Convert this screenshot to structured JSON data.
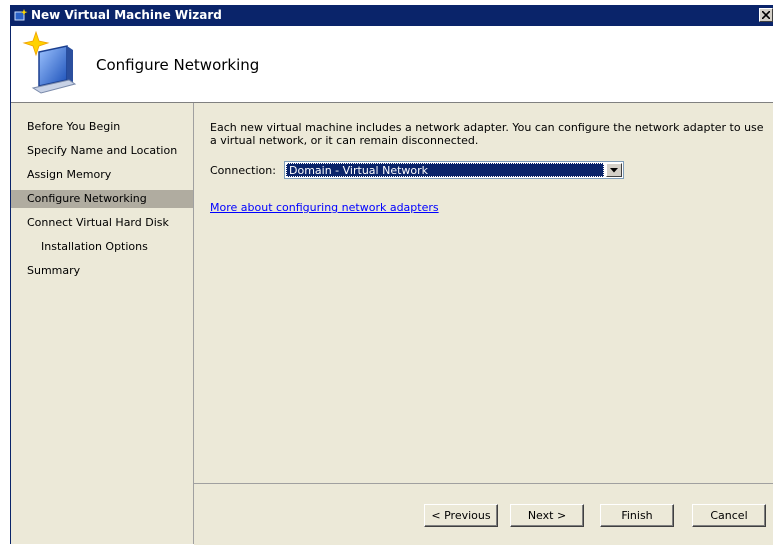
{
  "window": {
    "title": "New Virtual Machine Wizard",
    "close_glyph": "×",
    "icons": {
      "title": "wizard-app-icon",
      "header": "wizard-computer-icon"
    },
    "colors": {
      "titlebar": "#0a246a",
      "selected_nav": "#b0aca0",
      "link": "#0000ff",
      "face": "#ece9d8"
    }
  },
  "header": {
    "title": "Configure Networking"
  },
  "sidebar": {
    "items": [
      {
        "label": "Before You Begin"
      },
      {
        "label": "Specify Name and Location"
      },
      {
        "label": "Assign Memory"
      },
      {
        "label": "Configure Networking",
        "selected": true
      },
      {
        "label": "Connect Virtual Hard Disk"
      },
      {
        "label": "Installation Options",
        "indented": true
      },
      {
        "label": "Summary"
      }
    ]
  },
  "main": {
    "description": "Each new virtual machine includes a network adapter. You can configure the network adapter to use a virtual network, or it can remain disconnected.",
    "connection_label": "Connection:",
    "connection_value": "Domain - Virtual Network",
    "more_link": "More about configuring network adapters"
  },
  "buttons": {
    "previous": "< Previous",
    "next": "Next >",
    "finish": "Finish",
    "cancel": "Cancel"
  }
}
